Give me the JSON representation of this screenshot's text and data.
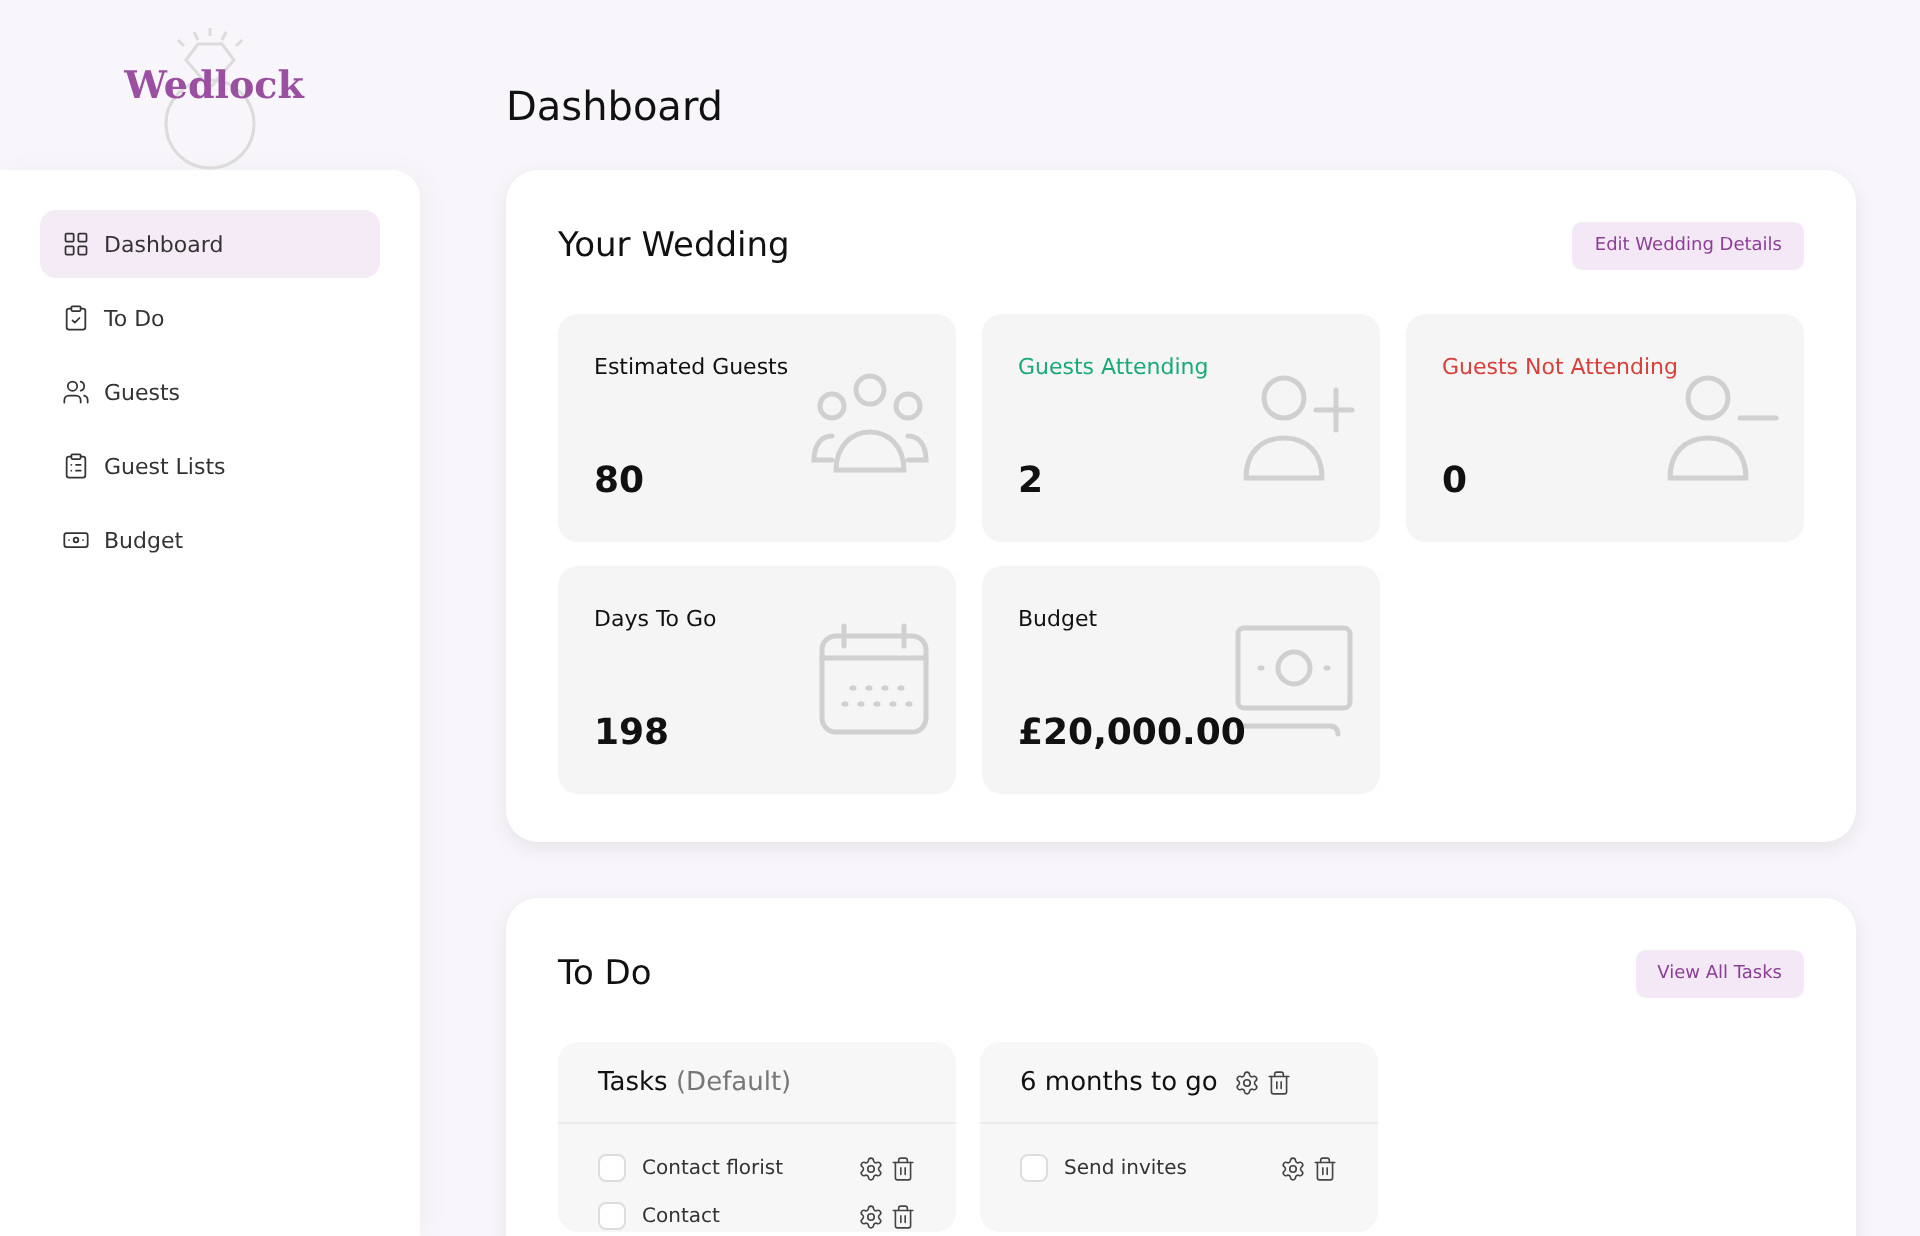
{
  "brand": {
    "name": "Wedlock"
  },
  "sidebar": {
    "items": [
      {
        "label": "Dashboard",
        "selected": true
      },
      {
        "label": "To Do",
        "selected": false
      },
      {
        "label": "Guests",
        "selected": false
      },
      {
        "label": "Guest Lists",
        "selected": false
      },
      {
        "label": "Budget",
        "selected": false
      }
    ]
  },
  "page_title": "Dashboard",
  "wedding": {
    "title": "Your Wedding",
    "button": "Edit Wedding Details",
    "stats": [
      {
        "label": "Estimated Guests",
        "value": "80",
        "color": "#111111"
      },
      {
        "label": "Guests Attending",
        "value": "2",
        "color": "#1aaa78"
      },
      {
        "label": "Guests Not Attending",
        "value": "0",
        "color": "#d9403a"
      },
      {
        "label": "Days To Go",
        "value": "198",
        "color": "#111111"
      },
      {
        "label": "Budget",
        "value": "£20,000.00",
        "color": "#111111"
      }
    ]
  },
  "todo": {
    "title": "To Do",
    "button": "View All Tasks",
    "lists": [
      {
        "title": "Tasks",
        "note": "(Default)",
        "tasks": [
          {
            "label": "Contact florist",
            "checked": false
          },
          {
            "label": "Contact",
            "checked": false
          }
        ]
      },
      {
        "title": "6 months to go",
        "tasks": [
          {
            "label": "Send invites",
            "checked": false
          }
        ]
      }
    ]
  }
}
